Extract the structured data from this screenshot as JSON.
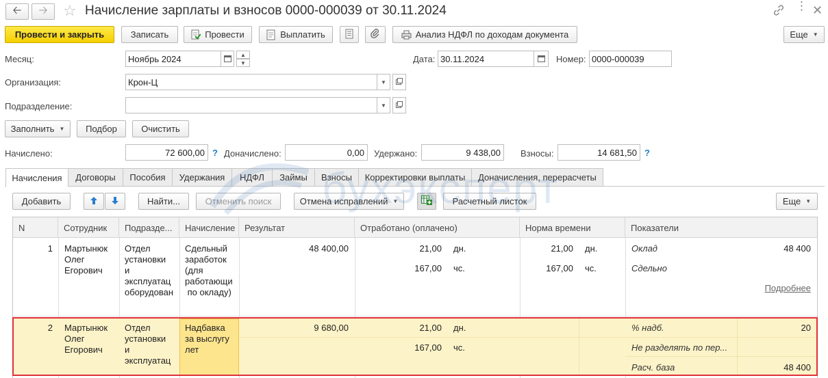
{
  "window": {
    "title": "Начисление зарплаты и взносов 0000-000039 от 30.11.2024"
  },
  "toolbar": {
    "post_close": "Провести и закрыть",
    "save": "Записать",
    "post": "Провести",
    "pay": "Выплатить",
    "analysis": "Анализ НДФЛ по доходам документа",
    "more": "Еще"
  },
  "form": {
    "month_label": "Месяц:",
    "month_value": "Ноябрь 2024",
    "date_label": "Дата:",
    "date_value": "30.11.2024",
    "number_label": "Номер:",
    "number_value": "0000-000039",
    "org_label": "Организация:",
    "org_value": "Крон-Ц",
    "dept_label": "Подразделение:",
    "dept_value": ""
  },
  "actions": {
    "fill": "Заполнить",
    "select": "Подбор",
    "clear": "Очистить"
  },
  "totals": {
    "accrued_label": "Начислено:",
    "accrued_value": "72 600,00",
    "extra_label": "Доначислено:",
    "extra_value": "0,00",
    "withheld_label": "Удержано:",
    "withheld_value": "9 438,00",
    "contrib_label": "Взносы:",
    "contrib_value": "14 681,50",
    "help": "?"
  },
  "tabs": [
    "Начисления",
    "Договоры",
    "Пособия",
    "Удержания",
    "НДФЛ",
    "Займы",
    "Взносы",
    "Корректировки выплаты",
    "Доначисления, перерасчеты"
  ],
  "watermark": "бухэксперт",
  "table_toolbar": {
    "add": "Добавить",
    "find": "Найти...",
    "cancel_search": "Отменить поиск",
    "cancel_corrections": "Отмена исправлений",
    "payslip": "Расчетный листок",
    "more": "Еще"
  },
  "table": {
    "columns": [
      "N",
      "Сотрудник",
      "Подразде...",
      "Начисление",
      "Результат",
      "Отработано (оплачено)",
      "Норма времени",
      "Показатели"
    ],
    "rows": [
      {
        "n": "1",
        "employee": [
          "Мартынюк",
          "Олег",
          "Егорович"
        ],
        "department": [
          "Отдел",
          "установки",
          "и",
          "эксплуатац",
          "оборудован"
        ],
        "accrual": [
          "Сдельный",
          "заработок",
          "(для",
          "работающи",
          " по окладу)"
        ],
        "result": "48 400,00",
        "worked_days": "21,00",
        "worked_days_unit": "дн.",
        "worked_hours": "167,00",
        "worked_hours_unit": "чс.",
        "norm_days": "21,00",
        "norm_days_unit": "дн.",
        "norm_hours": "167,00",
        "norm_hours_unit": "чс.",
        "indicators": [
          {
            "name": "Оклад",
            "value": "48 400"
          },
          {
            "name": "Сдельно",
            "value": ""
          }
        ],
        "more_link": "Подробнее"
      },
      {
        "n": "2",
        "employee": [
          "Мартынюк",
          "Олег",
          "Егорович"
        ],
        "department": [
          "Отдел",
          "установки",
          "и",
          "эксплуатац"
        ],
        "accrual": [
          "Надбавка",
          "за выслугу",
          "лет"
        ],
        "result": "9 680,00",
        "worked_days": "21,00",
        "worked_days_unit": "дн.",
        "worked_hours": "167,00",
        "worked_hours_unit": "чс.",
        "indicators": [
          {
            "name": "% надб.",
            "value": "20"
          },
          {
            "name": "Не разделять по пер...",
            "value": ""
          },
          {
            "name": "Расч. база",
            "value": "48 400"
          }
        ]
      }
    ]
  },
  "colors": {
    "primary_button": "#f5d000",
    "selected_row": "#fdf3c8",
    "selected_cell": "#fde58e",
    "highlight_border": "#e0303a",
    "help_icon": "#1c7fc9"
  }
}
